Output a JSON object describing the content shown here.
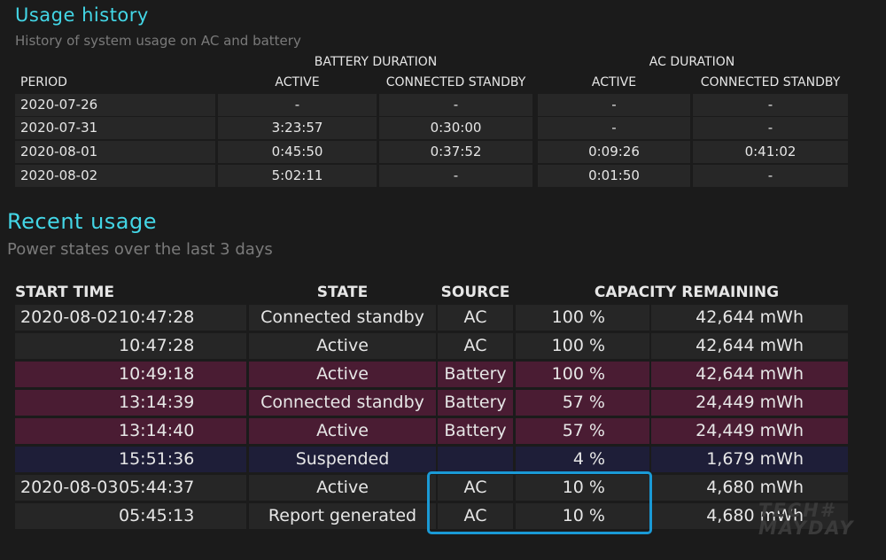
{
  "usage_history": {
    "title": "Usage history",
    "subtitle": "History of system usage on AC and battery",
    "group_battery": "BATTERY DURATION",
    "group_ac": "AC DURATION",
    "headers": [
      "PERIOD",
      "ACTIVE",
      "CONNECTED STANDBY",
      "ACTIVE",
      "CONNECTED STANDBY"
    ],
    "rows": [
      [
        "2020-07-26",
        "-",
        "-",
        "-",
        "-"
      ],
      [
        "2020-07-31",
        "3:23:57",
        "0:30:00",
        "-",
        "-"
      ],
      [
        "2020-08-01",
        "0:45:50",
        "0:37:52",
        "0:09:26",
        "0:41:02"
      ],
      [
        "2020-08-02",
        "5:02:11",
        "-",
        "0:01:50",
        "-"
      ]
    ]
  },
  "recent_usage": {
    "title": "Recent usage",
    "subtitle": "Power states over the last 3 days",
    "headers": {
      "start_time": "START TIME",
      "state": "STATE",
      "source": "SOURCE",
      "capacity": "CAPACITY REMAINING"
    },
    "rows": [
      {
        "date": "2020-08-02",
        "time": "10:47:28",
        "state": "Connected standby",
        "source": "AC",
        "pct": "100 %",
        "mwh": "42,644 mWh",
        "kind": "dark"
      },
      {
        "date": "",
        "time": "10:47:28",
        "state": "Active",
        "source": "AC",
        "pct": "100 %",
        "mwh": "42,644 mWh",
        "kind": "dark"
      },
      {
        "date": "",
        "time": "10:49:18",
        "state": "Active",
        "source": "Battery",
        "pct": "100 %",
        "mwh": "42,644 mWh",
        "kind": "bat"
      },
      {
        "date": "",
        "time": "13:14:39",
        "state": "Connected standby",
        "source": "Battery",
        "pct": "57 %",
        "mwh": "24,449 mWh",
        "kind": "bat"
      },
      {
        "date": "",
        "time": "13:14:40",
        "state": "Active",
        "source": "Battery",
        "pct": "57 %",
        "mwh": "24,449 mWh",
        "kind": "bat"
      },
      {
        "date": "",
        "time": "15:51:36",
        "state": "Suspended",
        "source": "",
        "pct": "4 %",
        "mwh": "1,679 mWh",
        "kind": "sus"
      },
      {
        "date": "2020-08-03",
        "time": "05:44:37",
        "state": "Active",
        "source": "AC",
        "pct": "10 %",
        "mwh": "4,680 mWh",
        "kind": "dark"
      },
      {
        "date": "",
        "time": "05:45:13",
        "state": "Report generated",
        "source": "AC",
        "pct": "10 %",
        "mwh": "4,680 mWh",
        "kind": "dark"
      }
    ]
  },
  "watermark": {
    "line1": "TECH#",
    "line2": "MAYDAY"
  },
  "colors": {
    "accent_title": "#43d6e6",
    "battery_row": "#4a1c33",
    "suspended_row": "#1e1e38",
    "highlight_box": "#1a9ad6"
  }
}
